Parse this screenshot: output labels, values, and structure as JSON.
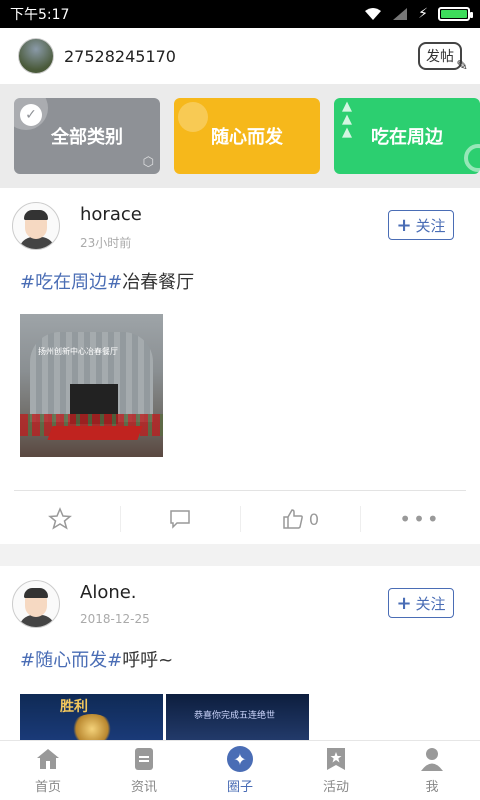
{
  "status": {
    "time": "下午5:17"
  },
  "header": {
    "username": "27528245170",
    "post_label": "发帖"
  },
  "categories": [
    {
      "label": "全部类别",
      "color": "#8e9196"
    },
    {
      "label": "随心而发",
      "color": "#f6b81b"
    },
    {
      "label": "吃在周边",
      "color": "#2ccf70"
    }
  ],
  "posts": [
    {
      "name": "horace",
      "time": "23小时前",
      "follow_label": "关注",
      "tag1": "#吃在周边",
      "tag2": "#",
      "text": "冶春餐厅",
      "photo_sign": "扬州创新中心冶春餐厅",
      "like_count": "0"
    },
    {
      "name": "Alone.",
      "time": "2018-12-25",
      "follow_label": "关注",
      "tag1": "#随心而发",
      "tag2": "#",
      "text": "呼呼~",
      "photo1_text": "胜利",
      "photo2_text": "恭喜你完成五连绝世"
    }
  ],
  "tabs": [
    {
      "label": "首页",
      "icon": "home-icon"
    },
    {
      "label": "资讯",
      "icon": "news-icon"
    },
    {
      "label": "圈子",
      "icon": "circle-icon"
    },
    {
      "label": "活动",
      "icon": "activity-icon"
    },
    {
      "label": "我",
      "icon": "profile-icon"
    }
  ],
  "colors": {
    "accent": "#4a6db5",
    "battery": "#3ddc5b"
  }
}
